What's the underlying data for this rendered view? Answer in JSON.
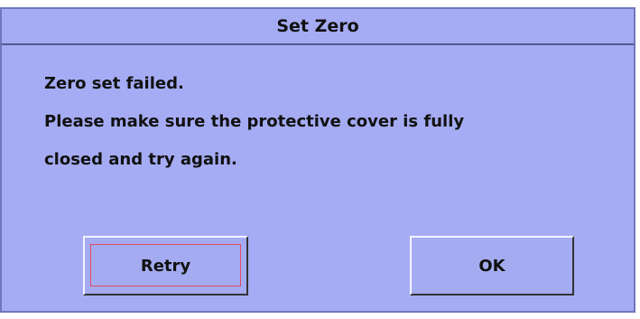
{
  "dialog": {
    "title": "Set Zero",
    "message_lines": [
      "Zero set failed.",
      "Please make sure the protective cover is fully",
      "closed and try again."
    ],
    "buttons": {
      "retry_label": "Retry",
      "ok_label": "OK"
    },
    "colors": {
      "background": "#a5acf3",
      "focus_border": "#e24d67"
    }
  }
}
